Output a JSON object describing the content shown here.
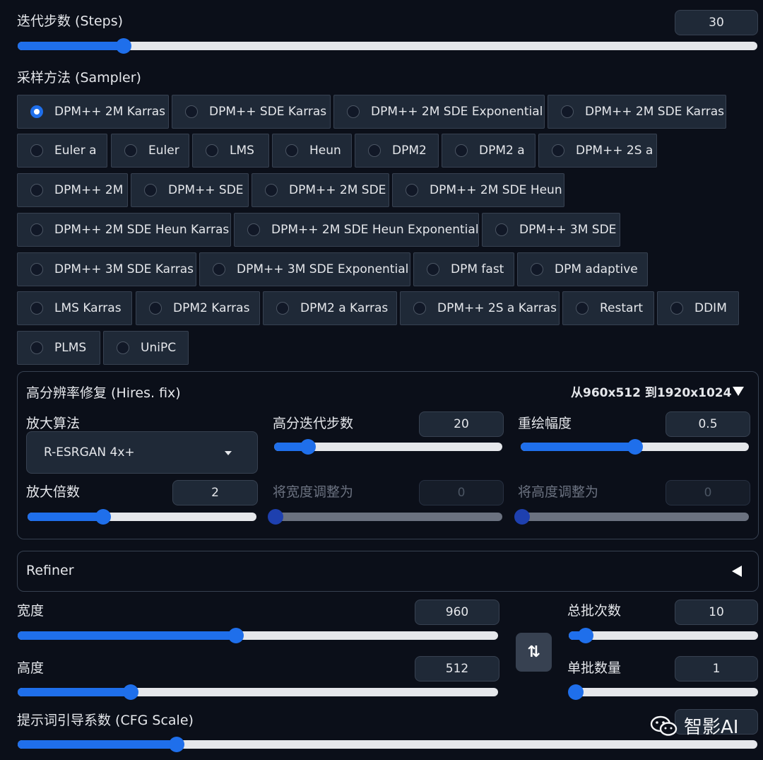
{
  "steps": {
    "label": "迭代步数 (Steps)",
    "value": "30",
    "fraction": 0.143
  },
  "sampler": {
    "label": "采样方法 (Sampler)",
    "selected": "DPM++ 2M Karras",
    "rows": [
      [
        "DPM++ 2M Karras",
        "DPM++ SDE Karras",
        "DPM++ 2M SDE Exponential",
        "DPM++ 2M SDE Karras"
      ],
      [
        "Euler a",
        "Euler",
        "LMS",
        "Heun",
        "DPM2",
        "DPM2 a",
        "DPM++ 2S a"
      ],
      [
        "DPM++ 2M",
        "DPM++ SDE",
        "DPM++ 2M SDE",
        "DPM++ 2M SDE Heun"
      ],
      [
        "DPM++ 2M SDE Heun Karras",
        "DPM++ 2M SDE Heun Exponential",
        "DPM++ 3M SDE"
      ],
      [
        "DPM++ 3M SDE Karras",
        "DPM++ 3M SDE Exponential",
        "DPM fast",
        "DPM adaptive"
      ],
      [
        "LMS Karras",
        "DPM2 Karras",
        "DPM2 a Karras",
        "DPM++ 2S a Karras",
        "Restart",
        "DDIM"
      ],
      [
        "PLMS",
        "UniPC"
      ]
    ]
  },
  "hires": {
    "title": "高分辨率修复 (Hires. fix)",
    "summary": "从960x512 到1920x1024",
    "collapse_icon": "triangle-down-icon",
    "upscaler_label": "放大算法",
    "upscaler_value": "R-ESRGAN 4x+",
    "hires_steps_label": "高分迭代步数",
    "hires_steps_value": "20",
    "hires_steps_fraction": 0.15,
    "denoise_label": "重绘幅度",
    "denoise_value": "0.5",
    "denoise_fraction": 0.5,
    "scale_label": "放大倍数",
    "scale_value": "2",
    "scale_fraction": 0.33,
    "resize_w_label": "将宽度调整为",
    "resize_w_value": "0",
    "resize_h_label": "将高度调整为",
    "resize_h_value": "0"
  },
  "refiner": {
    "title": "Refiner",
    "expand_icon": "triangle-left-icon"
  },
  "width": {
    "label": "宽度",
    "value": "960",
    "fraction": 0.455
  },
  "height": {
    "label": "高度",
    "value": "512",
    "fraction": 0.235
  },
  "batch_count": {
    "label": "总批次数",
    "value": "10",
    "fraction": 0.09
  },
  "batch_size": {
    "label": "单批数量",
    "value": "1",
    "fraction": 0.0
  },
  "swap_icon": "swap-vertical-icon",
  "cfg": {
    "label": "提示词引导系数 (CFG Scale)",
    "fraction": 0.215
  },
  "watermark": {
    "text": "智影AI",
    "icon": "wechat-icon"
  },
  "colors": {
    "accent": "#1f6feb",
    "background": "#0b0f19",
    "panel": "#1f2937"
  }
}
